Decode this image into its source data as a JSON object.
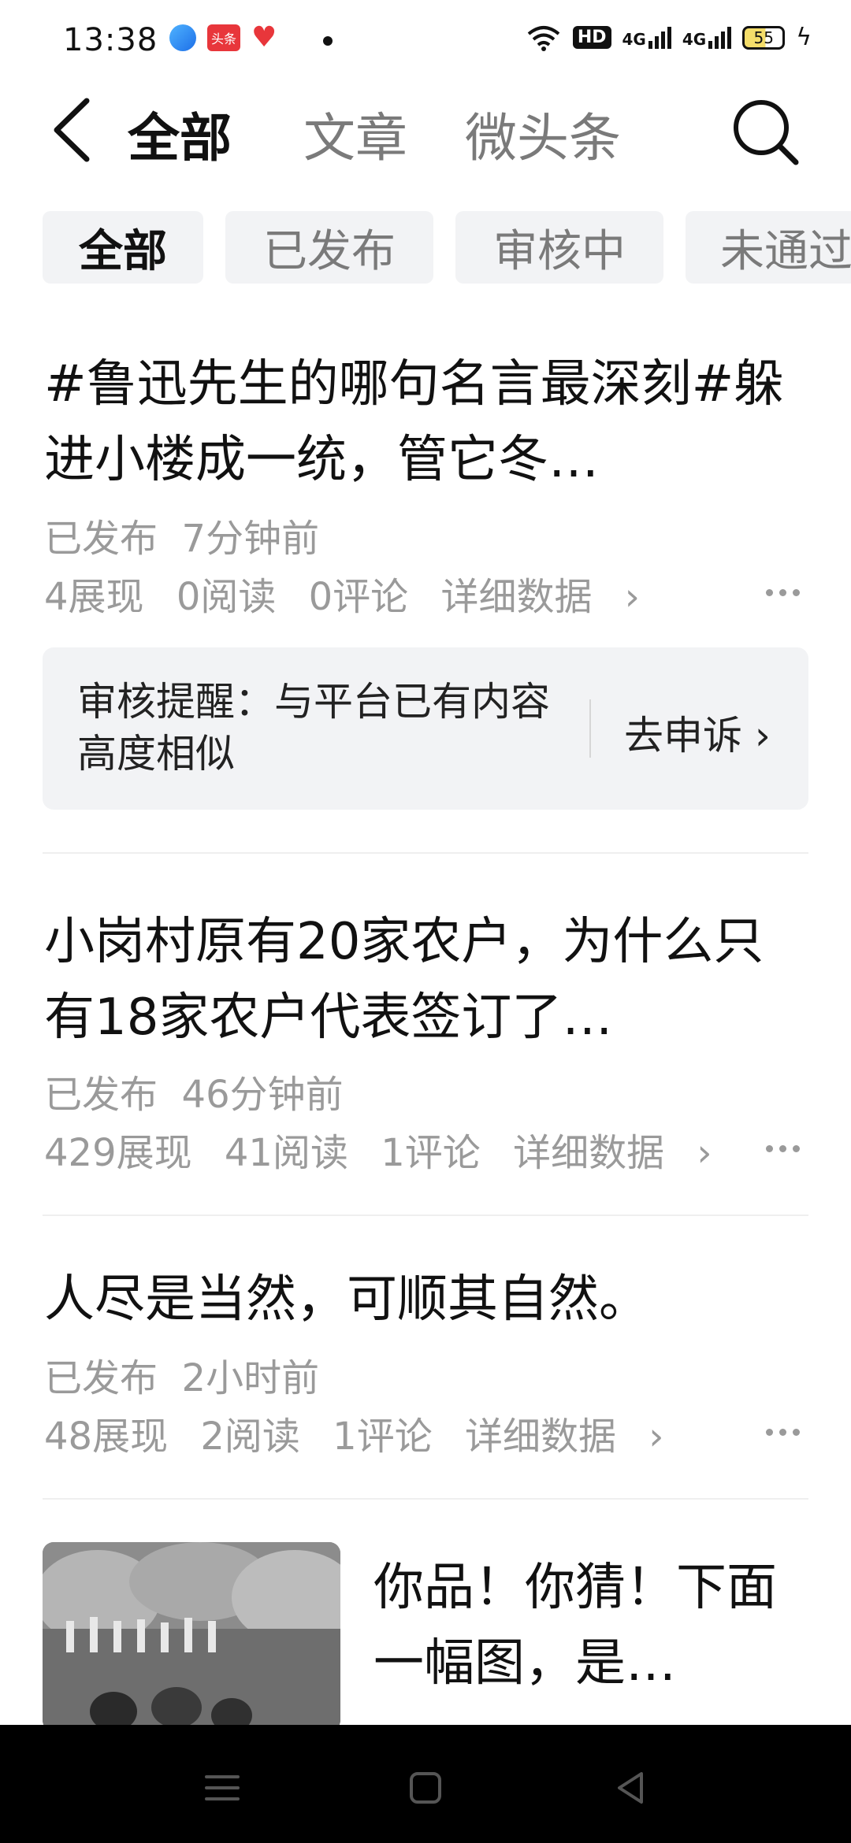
{
  "status_bar": {
    "time": "13:38",
    "app_label": "头条",
    "hd_label": "HD",
    "net1": "4G",
    "net2": "4G",
    "battery": "55"
  },
  "header": {
    "tabs": [
      {
        "label": "全部"
      },
      {
        "label": "文章"
      },
      {
        "label": "微头条"
      }
    ]
  },
  "filters": [
    {
      "label": "全部"
    },
    {
      "label": "已发布"
    },
    {
      "label": "审核中"
    },
    {
      "label": "未通过"
    }
  ],
  "items": [
    {
      "title": "#鲁迅先生的哪句名言最深刻#躲进小楼成一统，管它冬…",
      "status": "已发布",
      "time": "7分钟前",
      "impressions": "4展现",
      "reads": "0阅读",
      "comments": "0评论",
      "details": "详细数据"
    },
    {
      "title": "小岗村原有20家农户，为什么只有18家农户代表签订了…",
      "status": "已发布",
      "time": "46分钟前",
      "impressions": "429展现",
      "reads": "41阅读",
      "comments": "1评论",
      "details": "详细数据"
    },
    {
      "title": "人尽是当然，可顺其自然。",
      "status": "已发布",
      "time": "2小时前",
      "impressions": "48展现",
      "reads": "2阅读",
      "comments": "1评论",
      "details": "详细数据"
    },
    {
      "title": "你品！你猜！下面一幅图，是…"
    }
  ],
  "notice": {
    "text": "审核提醒：与平台已有内容高度相似",
    "action": "去申诉"
  },
  "colors": {
    "accent_text": "#111111",
    "muted_text": "#9a9a9a",
    "chip_bg": "#f2f3f5"
  }
}
